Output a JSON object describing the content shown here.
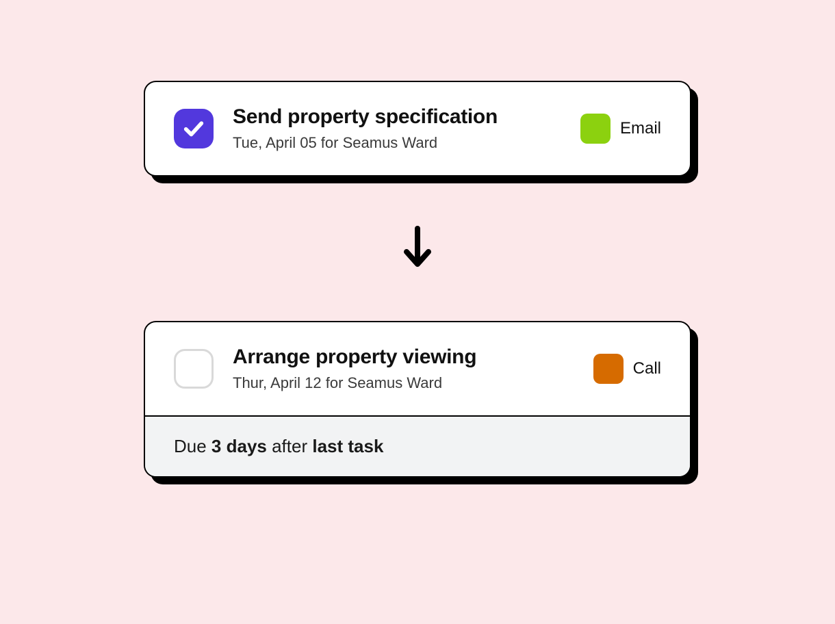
{
  "tasks": [
    {
      "title": "Send property specification",
      "subtitle": "Tue, April 05 for Seamus Ward",
      "checked": true,
      "tag": {
        "label": "Email",
        "color": "#8cd10f"
      }
    },
    {
      "title": "Arrange property viewing",
      "subtitle": "Thur, April 12 for Seamus Ward",
      "checked": false,
      "tag": {
        "label": "Call",
        "color": "#d66b00"
      }
    }
  ],
  "rule": {
    "prefix": "Due ",
    "duration": "3 days",
    "mid": " after ",
    "target": "last task"
  }
}
